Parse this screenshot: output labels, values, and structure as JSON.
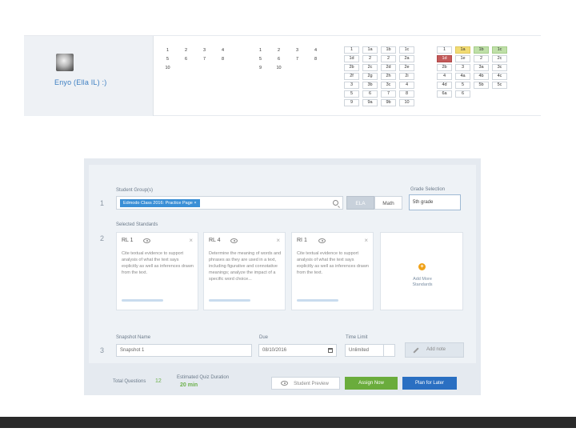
{
  "profile": {
    "name": "Enyo (Ella IL) :)"
  },
  "calendar": {
    "block_a": [
      [
        "1",
        "2",
        "3",
        "4"
      ],
      [
        "5",
        "6",
        "7",
        "8"
      ],
      [
        "10",
        "",
        "",
        ""
      ]
    ],
    "block_b": [
      [
        "1",
        "2",
        "3",
        "4"
      ],
      [
        "5",
        "6",
        "7",
        "8"
      ],
      [
        "9",
        "10",
        "",
        ""
      ]
    ],
    "block_c": [
      [
        "1",
        "1a",
        "1b",
        "1c"
      ],
      [
        "1d",
        "2",
        "2",
        "2a"
      ],
      [
        "2b",
        "2c",
        "2d",
        "2e"
      ],
      [
        "2f",
        "2g",
        "2h",
        "2i"
      ],
      [
        "3",
        "3b",
        "3c",
        "4"
      ],
      [
        "5",
        "6",
        "7",
        "8"
      ],
      [
        "9",
        "9a",
        "9b",
        "10"
      ]
    ],
    "block_d": [
      [
        {
          "v": "1"
        },
        {
          "v": "1a",
          "c": "yellow"
        },
        {
          "v": "1b",
          "c": "green"
        },
        {
          "v": "1c",
          "c": "green"
        }
      ],
      [
        {
          "v": "1d",
          "c": "red"
        },
        {
          "v": "1e"
        },
        {
          "v": "2"
        },
        {
          "v": "2c"
        }
      ],
      [
        {
          "v": "2b"
        },
        {
          "v": "3"
        },
        {
          "v": "3a"
        },
        {
          "v": "3c"
        }
      ],
      [
        {
          "v": "4"
        },
        {
          "v": "4a"
        },
        {
          "v": "4b"
        },
        {
          "v": "4c"
        }
      ],
      [
        {
          "v": "4d"
        },
        {
          "v": "5"
        },
        {
          "v": "5b"
        },
        {
          "v": "5c"
        }
      ],
      [
        {
          "v": "6a"
        },
        {
          "v": "6"
        },
        {
          "v": ""
        },
        {
          "v": ""
        }
      ]
    ]
  },
  "form": {
    "step1": {
      "num": "1",
      "label": "Student Group(s)",
      "tag": "Edmodo Class 2016: Practice Page",
      "subjects": [
        "ELA",
        "Math"
      ],
      "grade_label": "Grade Selection",
      "grade_value": "5th grade"
    },
    "step2": {
      "num": "2",
      "label": "Selected Standards",
      "standards": [
        {
          "title": "RL 1",
          "desc": "Cite textual evidence to support analysis of what the text says explicitly as well as inferences drawn from the text."
        },
        {
          "title": "RL 4",
          "desc": "Determine the meaning of words and phrases as they are used in a text, including figurative and connotative meanings; analyze the impact of a specific word choice..."
        },
        {
          "title": "RI 1",
          "desc": "Cite textual evidence to support analysis of what the text says explicitly as well as inferences drawn from the text."
        }
      ],
      "add_label": "Add More Standards"
    },
    "step3": {
      "num": "3",
      "snapshot_label": "Snapshot Name",
      "snapshot_value": "Snapshot 1",
      "due_label": "Due",
      "due_value": "08/10/2016",
      "time_label": "Time Limit",
      "time_value": "Unlimited",
      "note_label": "Add note"
    }
  },
  "footer": {
    "total_label": "Total Questions",
    "total_value": "12",
    "duration_label": "Estimated Quiz Duration",
    "duration_value": "20 min",
    "preview": "Student Preview",
    "assign": "Assign Now",
    "plan": "Plan for Later"
  },
  "colors": {
    "primary": "#2a6fc2",
    "success": "#6aac3c",
    "tag": "#3a8fd6",
    "accent": "#f0a21a"
  }
}
